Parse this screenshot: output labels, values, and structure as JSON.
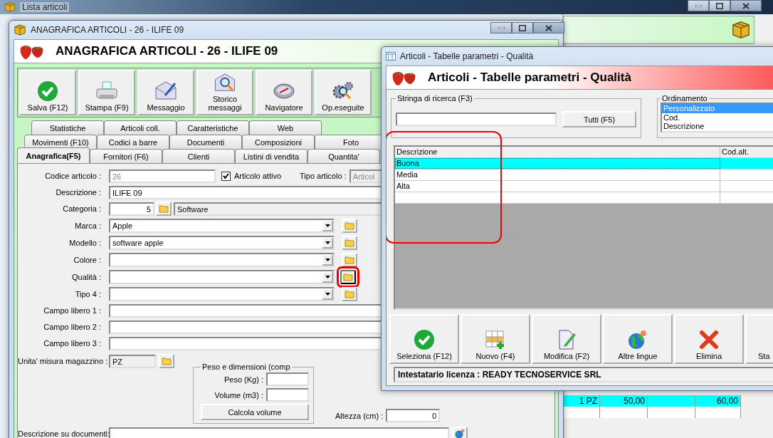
{
  "back_window": {
    "title": "Lista articoli",
    "grid_row": {
      "column_1": "1 PZ",
      "column_2": "50,00",
      "column_4": "60,00"
    }
  },
  "main_window": {
    "title": "ANAGRAFICA ARTICOLI - 26 - ILIFE 09",
    "header": "ANAGRAFICA ARTICOLI - 26 - ILIFE 09",
    "toolbar": [
      "Salva (F12)",
      "Stampa (F9)",
      "Messaggio",
      "Storico messaggi",
      "Navigatore",
      "Op.eseguite"
    ],
    "tab_rows": [
      [
        {
          "label": "Statistiche",
          "selected": false
        },
        {
          "label": "Articoli coll.",
          "selected": false
        },
        {
          "label": "Caratteristiche",
          "selected": false
        },
        {
          "label": "Web",
          "selected": false
        }
      ],
      [
        {
          "label": "Movimenti (F10)",
          "selected": false
        },
        {
          "label": "Codici a barre",
          "selected": false
        },
        {
          "label": "Documenti",
          "selected": false
        },
        {
          "label": "Composizioni",
          "selected": false
        },
        {
          "label": "Foto",
          "selected": false
        }
      ],
      [
        {
          "label": "Anagrafica(F5)",
          "selected": true
        },
        {
          "label": "Fornitori (F6)",
          "selected": false
        },
        {
          "label": "Clienti",
          "selected": false
        },
        {
          "label": "Listini di vendita",
          "selected": false
        },
        {
          "label": "Quantita'",
          "selected": false
        }
      ]
    ],
    "form": {
      "codice": {
        "label": "Codice articolo :",
        "value": "26",
        "disabled": true
      },
      "attivo": {
        "label": "Articolo attivo",
        "checked": true
      },
      "tipo": {
        "label": "Tipo articolo :",
        "value": "Articol",
        "disabled": true
      },
      "descrizione": {
        "label": "Descrizione :",
        "value": "ILIFE 09"
      },
      "categoria": {
        "label": "Categoria :",
        "code": "5",
        "name": "Software"
      },
      "combos": [
        {
          "label": "Marca :",
          "value": "Apple",
          "highlighted": false
        },
        {
          "label": "Modello :",
          "value": "software apple",
          "highlighted": false
        },
        {
          "label": "Colore :",
          "highlighted": false
        },
        {
          "label": "Qualità :",
          "highlighted": true
        },
        {
          "label": "Tipo 4 :",
          "highlighted": false
        }
      ],
      "free_fields": [
        "Campo libero 1 :",
        "Campo libero 2 :",
        "Campo libero 3 :"
      ],
      "unita": {
        "label": "Unita' misura magazzino :",
        "value": "PZ"
      },
      "peso": {
        "legend": "Peso e dimensioni (comp",
        "fields": [
          "Peso (Kg) :",
          "Volume (m3) :"
        ],
        "button": "Calcola volume"
      },
      "altezza": {
        "label": "Altezza (cm) :",
        "value": "0"
      },
      "doc_desc": {
        "label": "Descrizione su documenti:"
      }
    }
  },
  "dialog": {
    "title": "Articoli - Tabelle parametri - Qualità",
    "header": "Articoli - Tabelle parametri - Qualità",
    "search": {
      "legend": "Stringa di ricerca (F3)",
      "button": "Tutti (F5)"
    },
    "ordering": {
      "legend": "Ordinamento",
      "options": [
        {
          "label": "Personalizzato",
          "selected": true
        },
        {
          "label": "Cod.",
          "selected": false
        },
        {
          "label": "Descrizione",
          "selected": false
        }
      ]
    },
    "grid": {
      "annotated": true,
      "columns": [
        "Descrizione",
        "Cod.alt."
      ],
      "rows": [
        {
          "descrizione": "Buona",
          "selected": true
        },
        {
          "descrizione": "Media",
          "selected": false
        },
        {
          "descrizione": "Alta",
          "selected": false
        }
      ]
    },
    "buttons": [
      "Seleziona (F12)",
      "Nuovo (F4)",
      "Modifica (F2)",
      "Altre lingue",
      "Elimina",
      "Sta"
    ],
    "status": "Intestatario licenza : READY TECNOSERVICE SRL"
  }
}
